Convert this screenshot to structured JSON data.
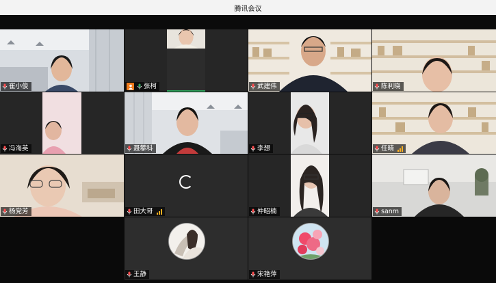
{
  "window": {
    "title": "腾讯会议"
  },
  "participants": [
    {
      "name": "崔小俊"
    },
    {
      "name": "张柯"
    },
    {
      "name": "武建伟"
    },
    {
      "name": "陈利晓"
    },
    {
      "name": "冯海英"
    },
    {
      "name": "聂攀科"
    },
    {
      "name": "李想"
    },
    {
      "name": "任晴"
    },
    {
      "name": "杨党芳"
    },
    {
      "name": "田大哥"
    },
    {
      "name": "仲昭楠"
    },
    {
      "name": "sanm"
    },
    {
      "name": "王静"
    },
    {
      "name": "宋艳萍"
    }
  ],
  "colors": {
    "active_speaker": "#2ea05a",
    "host_badge": "#f07a1a",
    "signal": "#ffb020",
    "mic": "#ff4d4f"
  },
  "icons": {
    "mic": "microphone-icon",
    "signal": "signal-icon",
    "host": "host-icon",
    "loading": "loading-spinner-icon"
  }
}
